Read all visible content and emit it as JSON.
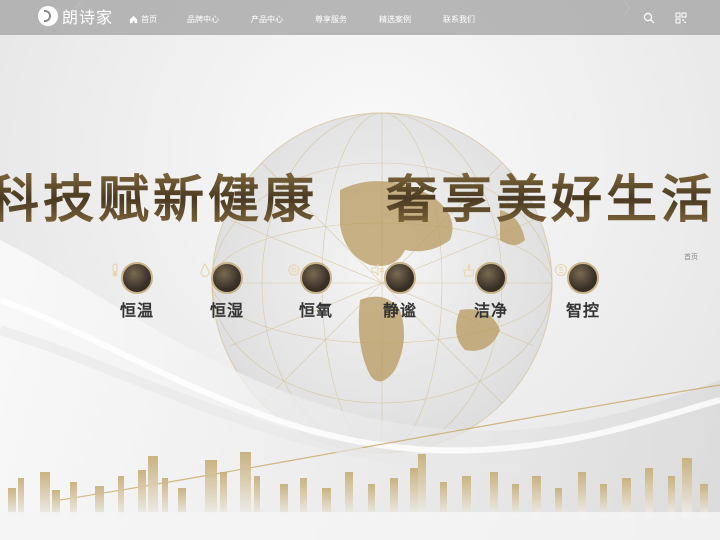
{
  "brand": {
    "name": "朗诗家"
  },
  "nav": {
    "items": [
      {
        "label": "首页",
        "icon": "home-icon"
      },
      {
        "label": "品牌中心"
      },
      {
        "label": "产品中心"
      },
      {
        "label": "尊享服务"
      },
      {
        "label": "精选案例"
      },
      {
        "label": "联系我们"
      }
    ],
    "tools": {
      "search": "search-icon",
      "qr": "qrcode-icon"
    }
  },
  "hero": {
    "headline_left": "科技赋新健康",
    "headline_right": "奢享美好生活",
    "more_label": "首页",
    "features": [
      {
        "label": "恒温",
        "icon": "thermometer-icon"
      },
      {
        "label": "恒湿",
        "icon": "droplet-icon"
      },
      {
        "label": "恒氧",
        "icon": "oxygen-icon"
      },
      {
        "label": "静谧",
        "icon": "mute-speaker-icon"
      },
      {
        "label": "洁净",
        "icon": "clean-brush-icon"
      },
      {
        "label": "智控",
        "icon": "smart-control-icon"
      }
    ]
  },
  "colors": {
    "gold": "#b89a5e",
    "headline": "#5a4628",
    "nav_bg": "#a0a0a0"
  }
}
